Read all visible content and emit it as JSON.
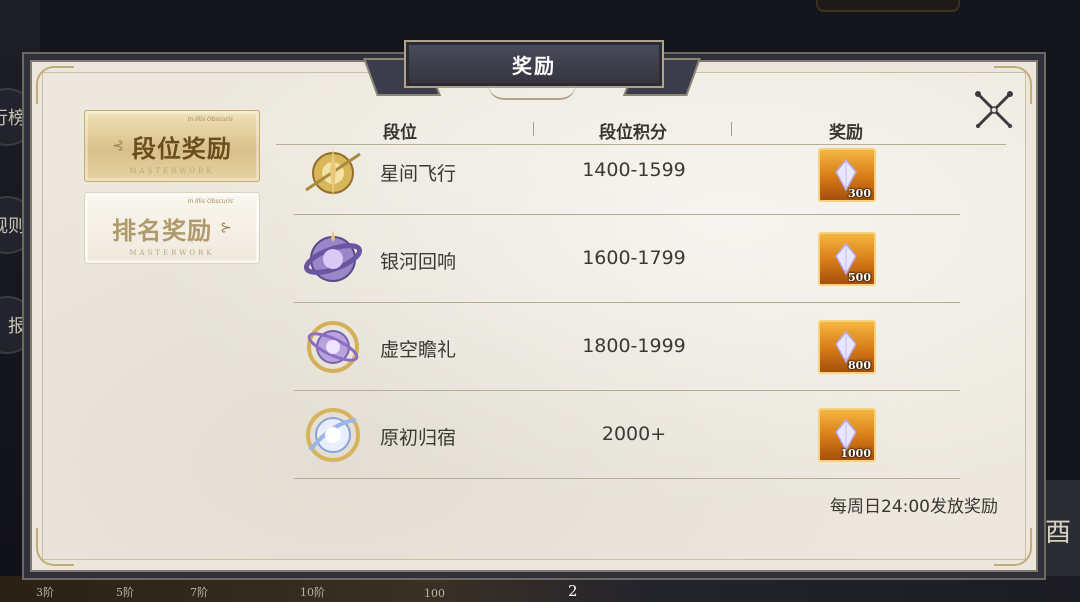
{
  "background": {
    "left_buttons": [
      "行榜",
      "规则",
      "报"
    ],
    "right_text": "酉",
    "bottom_labels": [
      "3阶",
      "5阶",
      "7阶",
      "10阶"
    ],
    "bottom_badge": "100",
    "bottom_num": "2"
  },
  "title": "奖励",
  "tabs": [
    {
      "label": "段位奖励",
      "small": "In Illis Obscuris",
      "sub": "MASTERWORK",
      "active": true
    },
    {
      "label": "排名奖励",
      "small": "In Illis Obscuris",
      "sub": "MASTERWORK",
      "active": false
    }
  ],
  "table": {
    "headers": {
      "rank": "段位",
      "score": "段位积分",
      "reward": "奖励"
    },
    "rows": [
      {
        "name": "星间飞行",
        "score": "1400-1599",
        "reward_count": "300",
        "icon": "star-flight-rank-icon"
      },
      {
        "name": "银河回响",
        "score": "1600-1799",
        "reward_count": "500",
        "icon": "galaxy-echo-rank-icon"
      },
      {
        "name": "虚空瞻礼",
        "score": "1800-1999",
        "reward_count": "800",
        "icon": "void-homage-rank-icon"
      },
      {
        "name": "原初归宿",
        "score": "2000+",
        "reward_count": "1000",
        "icon": "primordial-home-rank-icon"
      }
    ]
  },
  "footer_note": "每周日24:00发放奖励",
  "colors": {
    "panel": "#ece8de",
    "title_bg": "#3f404f",
    "active_tab": "#d9c08a",
    "reward_bg": "#d67a16"
  }
}
